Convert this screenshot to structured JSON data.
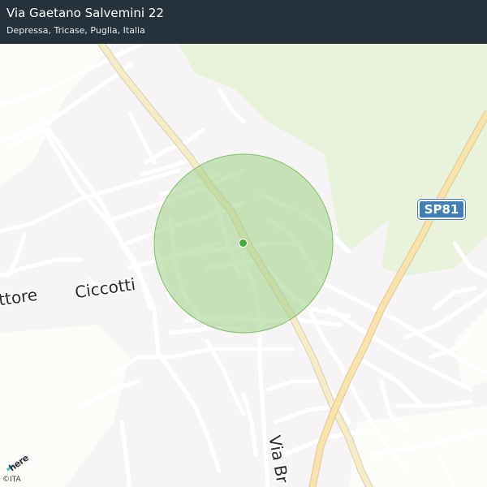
{
  "header": {
    "title": "Via Gaetano Salvemini 22",
    "subtitle": "Depressa, Tricase, Puglia, Italia"
  },
  "map": {
    "road_labels": {
      "vittore": "ttore",
      "ciccotti": "Ciccotti",
      "via_br": "Via Br"
    },
    "route_shield": "SP81",
    "brand": "here",
    "copyright": "©ITA",
    "colors": {
      "background": "#f6f4f4",
      "green_area": "#e9f3dc",
      "accuracy_circle": "#9fcf86",
      "location_pin": "#3fae3f",
      "main_road": "#f4e2b0",
      "header": "#26323b",
      "shield": "#3f7fb4"
    },
    "icons": [
      "location-dot-icon",
      "here-logo-icon"
    ]
  }
}
